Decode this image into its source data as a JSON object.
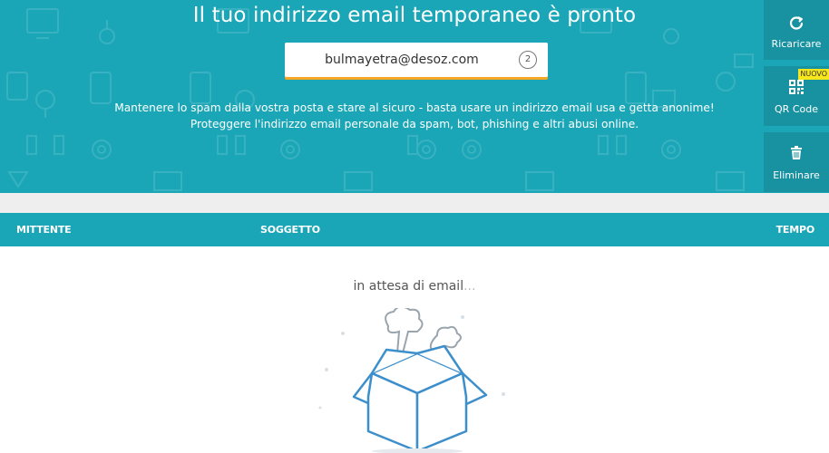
{
  "hero": {
    "title": "Il tuo indirizzo email temporaneo è pronto",
    "email": "bulmayetra@desoz.com",
    "copy_count": "2",
    "description": "Mantenere lo spam dalla vostra posta e stare al sicuro - basta usare un indirizzo email usa e getta anonime! Proteggere l'indirizzo email personale da spam, bot, phishing e altri abusi online."
  },
  "side": {
    "refresh_label": "Ricaricare",
    "qr_label": "QR Code",
    "new_badge": "NUOVO",
    "delete_label": "Eliminare"
  },
  "table": {
    "col_sender": "MITTENTE",
    "col_subject": "SOGGETTO",
    "col_time": "TEMPO"
  },
  "inbox": {
    "waiting_text": "in attesa di email",
    "waiting_dots": "..."
  },
  "colors": {
    "primary": "#1aa6b7",
    "primary_dark": "#1891a1",
    "accent": "#f5a623",
    "badge": "#f7e61b",
    "illustration": "#4a90c8"
  }
}
